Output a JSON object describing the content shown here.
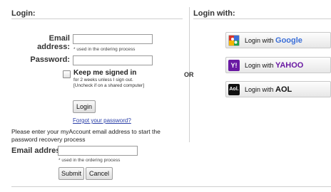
{
  "left_header": "Login:",
  "right_header": "Login with:",
  "or_label": "OR",
  "login_form": {
    "email_label": "Email address:",
    "email_value": "",
    "email_hint": "* used in the ordering process",
    "password_label": "Password:",
    "password_value": "",
    "keep_signed_in_label": "Keep me signed in",
    "keep_signed_in_note_1": "for 2 weeks unless I sign out.",
    "keep_signed_in_note_2": "[Uncheck if on a shared computer]",
    "keep_signed_in_checked": false,
    "login_button": "Login",
    "forgot_link": "Forgot your password?"
  },
  "recovery": {
    "instructions_line1": "Please enter your myAccount email address to start the",
    "instructions_line2": "password recovery process",
    "email_label": "Email address:",
    "email_value": "",
    "email_hint": "* used in the ordering process",
    "submit_button": "Submit",
    "cancel_button": "Cancel"
  },
  "providers": [
    {
      "prefix": "Login with ",
      "name": "Google",
      "icon": "google-icon",
      "accent": "#3b6fd8"
    },
    {
      "prefix": "Login with ",
      "name": "YAHOO",
      "icon": "yahoo-icon",
      "accent": "#6a1aa3"
    },
    {
      "prefix": "Login with ",
      "name": "AOL",
      "icon": "aol-icon",
      "accent": "#111111"
    }
  ]
}
